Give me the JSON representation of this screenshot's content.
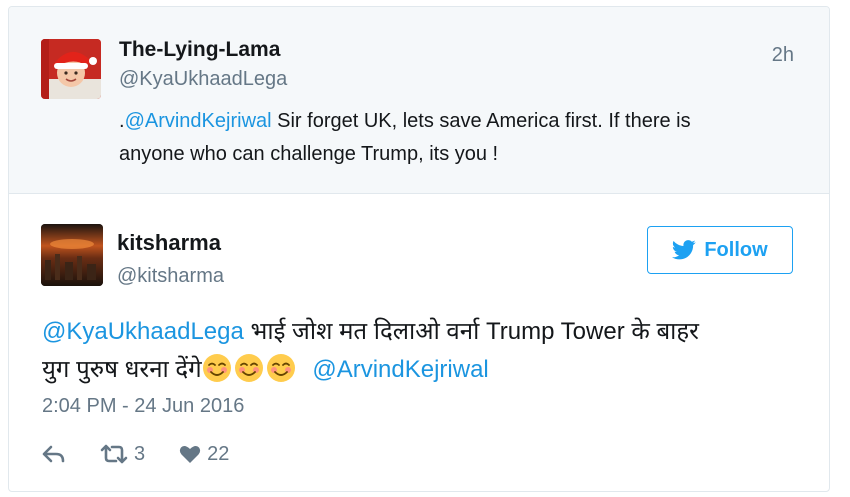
{
  "parent_tweet": {
    "display_name": "The-Lying-Lama",
    "handle": "@KyaUkhaadLega",
    "time": "2h",
    "text_prefix": ".",
    "mention": "@ArvindKejriwal",
    "text_line1_rest": " Sir forget UK, lets save America first. If there is",
    "text_line2": "anyone who can challenge Trump, its you !"
  },
  "main_tweet": {
    "display_name": "kitsharma",
    "handle": "@kitsharma",
    "follow_label": "Follow",
    "mention1": "@KyaUkhaadLega",
    "text_line1_rest": " भाई जोश मत दिलाओ वर्ना Trump Tower के बाहर",
    "text_line2": "युग पुरुष धरना देंगे",
    "emoji_count": 3,
    "mention2": "@ArvindKejriwal",
    "timestamp": "2:04 PM - 24 Jun 2016",
    "retweets": "3",
    "likes": "22"
  },
  "icons": {
    "follow": "twitter-bird-icon",
    "reply": "reply-icon",
    "retweet": "retweet-icon",
    "like": "heart-icon",
    "emoji": "smiling-face-emoji"
  },
  "colors": {
    "link": "#1b95e0",
    "brand": "#1da1f2",
    "muted": "#657786",
    "parent_bg": "#f5f8fa",
    "emoji": "#ffcc4d"
  }
}
